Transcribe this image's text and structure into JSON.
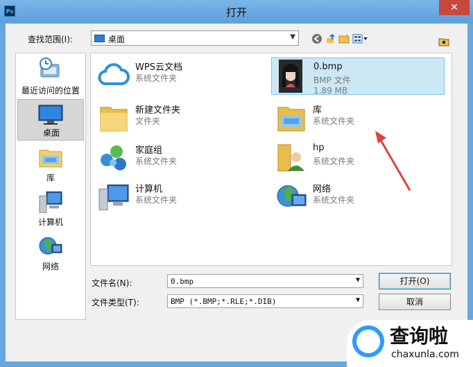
{
  "window": {
    "title": "打开",
    "app_icon": "Ps",
    "close_glyph": "✕"
  },
  "lookin": {
    "label": "查找范围(I):",
    "value": "桌面"
  },
  "toolbar": [
    "back-icon",
    "up-folder-icon",
    "new-folder-icon",
    "view-menu-icon"
  ],
  "places": [
    {
      "label": "最近访问的位置",
      "icon": "recent-places-icon"
    },
    {
      "label": "桌面",
      "icon": "desktop-icon",
      "selected": true
    },
    {
      "label": "库",
      "icon": "library-icon"
    },
    {
      "label": "计算机",
      "icon": "computer-icon"
    },
    {
      "label": "网络",
      "icon": "network-icon"
    }
  ],
  "files": [
    {
      "name": "WPS云文档",
      "type": "系统文件夹",
      "icon": "cloud-icon"
    },
    {
      "name": "0.bmp",
      "type": "BMP 文件",
      "size": "1.89 MB",
      "icon": "image-thumbnail",
      "selected": true
    },
    {
      "name": "新建文件夹",
      "type": "文件夹",
      "icon": "folder-icon"
    },
    {
      "name": "库",
      "type": "系统文件夹",
      "icon": "library-icon"
    },
    {
      "name": "家庭组",
      "type": "系统文件夹",
      "icon": "homegroup-icon"
    },
    {
      "name": "hp",
      "type": "系统文件夹",
      "icon": "user-folder-icon"
    },
    {
      "name": "计算机",
      "type": "系统文件夹",
      "icon": "computer-icon"
    },
    {
      "name": "网络",
      "type": "系统文件夹",
      "icon": "network-icon"
    }
  ],
  "filename": {
    "label": "文件名(N):",
    "value": "0.bmp"
  },
  "filetype": {
    "label": "文件类型(T):",
    "value": "BMP (*.BMP;*.RLE;*.DIB)"
  },
  "buttons": {
    "open": "打开(O)",
    "cancel": "取消"
  },
  "watermark": {
    "text": "查询啦",
    "url": "chaxunla.com"
  },
  "colors": {
    "titlebar": "#68a8e0",
    "selection": "#cce8f4",
    "close": "#c7493e",
    "arrow": "#e0423c"
  }
}
